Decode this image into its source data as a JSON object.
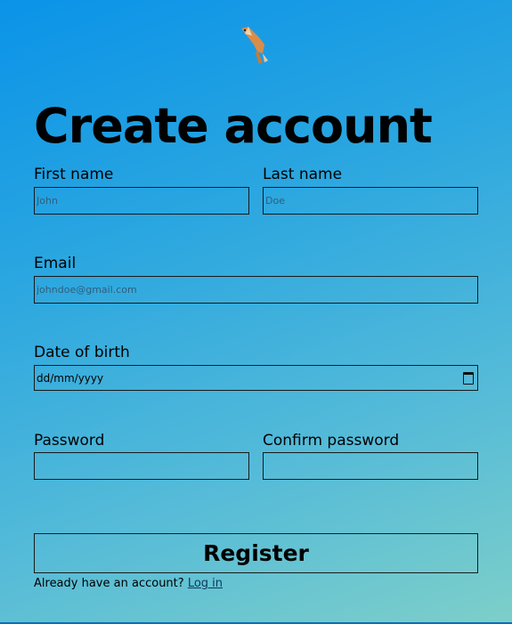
{
  "header": {
    "logo_icon": "flying-fox-icon",
    "title": "Create account"
  },
  "form": {
    "first_name": {
      "label": "First name",
      "placeholder": "John"
    },
    "last_name": {
      "label": "Last name",
      "placeholder": "Doe"
    },
    "email": {
      "label": "Email",
      "placeholder": "johndoe@gmail.com"
    },
    "dob": {
      "label": "Date of birth",
      "value": "dd/mm/yyyy"
    },
    "password": {
      "label": "Password"
    },
    "confirm_password": {
      "label": "Confirm password"
    },
    "register_label": "Register"
  },
  "footer": {
    "prompt": "Already have an account?",
    "login_link": "Log in"
  },
  "colors": {
    "bg_top": "#0a93e8",
    "bg_bottom": "#7dcfc9"
  }
}
